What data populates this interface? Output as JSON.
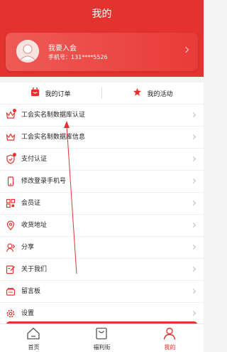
{
  "header": {
    "title": "我的"
  },
  "user": {
    "title": "我要入会",
    "phone": "手机号：131****5526"
  },
  "orders": {
    "my_orders": "我的订单",
    "my_activities": "我的活动"
  },
  "menu": [
    {
      "label": "工会实名制数据库认证",
      "icon": "crown-icon",
      "dot": true
    },
    {
      "label": "工会实名制数据库信息",
      "icon": "crown-icon",
      "dot": false
    },
    {
      "label": "支付认证",
      "icon": "shield-icon",
      "dot": true
    },
    {
      "label": "修改登录手机号",
      "icon": "phone-icon",
      "dot": false
    },
    {
      "label": "会员证",
      "icon": "qr-card-icon",
      "dot": false
    },
    {
      "label": "收货地址",
      "icon": "location-icon",
      "dot": false
    },
    {
      "label": "分享",
      "icon": "share-icon",
      "dot": false
    },
    {
      "label": "关于我们",
      "icon": "edit-note-icon",
      "dot": false
    },
    {
      "label": "留言板",
      "icon": "message-board-icon",
      "dot": false
    },
    {
      "label": "设置",
      "icon": "gear-icon",
      "dot": false
    }
  ],
  "tabbar": [
    {
      "label": "首页",
      "icon": "home-icon",
      "active": false
    },
    {
      "label": "福利街",
      "icon": "shopping-bag-icon",
      "active": false
    },
    {
      "label": "我的",
      "icon": "profile-icon",
      "active": true
    }
  ],
  "colors": {
    "brand_red": "#e4322e",
    "background": "#f3f3f3"
  }
}
